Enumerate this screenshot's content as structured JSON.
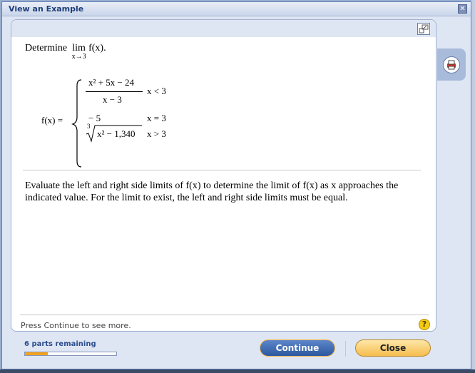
{
  "window": {
    "title": "View an Example",
    "close_glyph": "✕"
  },
  "question": {
    "prompt_word": "Determine",
    "lim_word": "lim",
    "lim_sub": "x→3",
    "lim_fx": "f(x)."
  },
  "piecewise": {
    "lhs": "f(x) =",
    "row1_num": "x² + 5x − 24",
    "row1_den": "x − 3",
    "row1_cond": "x < 3",
    "row2_expr": "− 5",
    "row2_cond": "x = 3",
    "row3_index": "3",
    "row3_radicand": "x² − 1,340",
    "row3_cond": "x > 3"
  },
  "explanation": "Evaluate the left and right side limits of f(x) to determine the limit of f(x) as x approaches the indicated value. For the limit to exist, the left and right side limits must be equal.",
  "footer": {
    "hint": "Press Continue to see more.",
    "help_glyph": "?"
  },
  "progress": {
    "label": "6 parts remaining",
    "fraction": 0.25
  },
  "buttons": {
    "continue": "Continue",
    "close": "Close"
  },
  "icons": {
    "expand": "expand-icon",
    "print": "print-icon",
    "help": "help-icon",
    "close": "close-icon"
  },
  "colors": {
    "accent": "#2c58a0",
    "progress_fill": "#f3a21d",
    "close_button": "#f6bd4e",
    "title_text": "#1f3f7a"
  }
}
